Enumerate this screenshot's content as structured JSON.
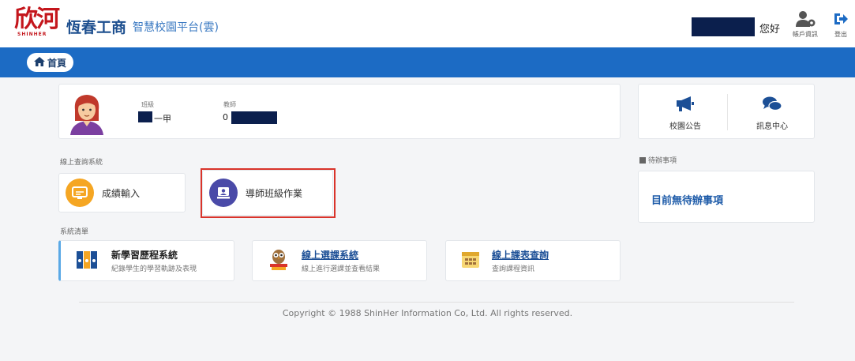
{
  "header": {
    "logo_text": "欣河",
    "logo_subtext": "SHINHER",
    "school_name": "恆春工商",
    "platform_name": "智慧校園平台(雲)",
    "greeting": "您好",
    "account_label": "帳戶資訊",
    "logout_label": "登出"
  },
  "nav": {
    "home_label": "首頁"
  },
  "profile": {
    "class_label": "班級",
    "class_value": "一甲",
    "teacher_label": "教師",
    "teacher_value": "0"
  },
  "quick_links": [
    {
      "label": "校園公告",
      "icon": "megaphone-icon"
    },
    {
      "label": "訊息中心",
      "icon": "chat-bubbles-icon"
    }
  ],
  "online_query": {
    "section_title": "線上查詢系統",
    "items": [
      {
        "label": "成績輸入",
        "icon": "score-input-icon",
        "color": "#f5a623"
      },
      {
        "label": "導師班級作業",
        "icon": "homeroom-icon",
        "color": "#4a4aa8"
      }
    ]
  },
  "todo": {
    "section_title": "待辦事項",
    "empty_text": "目前無待辦事項"
  },
  "system_list": {
    "section_title": "系統清單",
    "items": [
      {
        "title": "新學習歷程系統",
        "desc": "紀錄學生的學習軌跡及表現",
        "icon": "binders-icon"
      },
      {
        "title": "線上選課系統",
        "desc": "線上進行選課並查看結果",
        "icon": "owl-books-icon"
      },
      {
        "title": "線上課表查詢",
        "desc": "查詢課程資訊",
        "icon": "calendar-icon"
      }
    ]
  },
  "footer": {
    "copyright": "Copyright © 1988 ShinHer Information Co, Ltd. All rights reserved."
  },
  "colors": {
    "nav_blue": "#1c6bc4",
    "brand_red": "#c4161c",
    "redaction": "#0b1f4d",
    "highlight_red": "#d9342b"
  }
}
